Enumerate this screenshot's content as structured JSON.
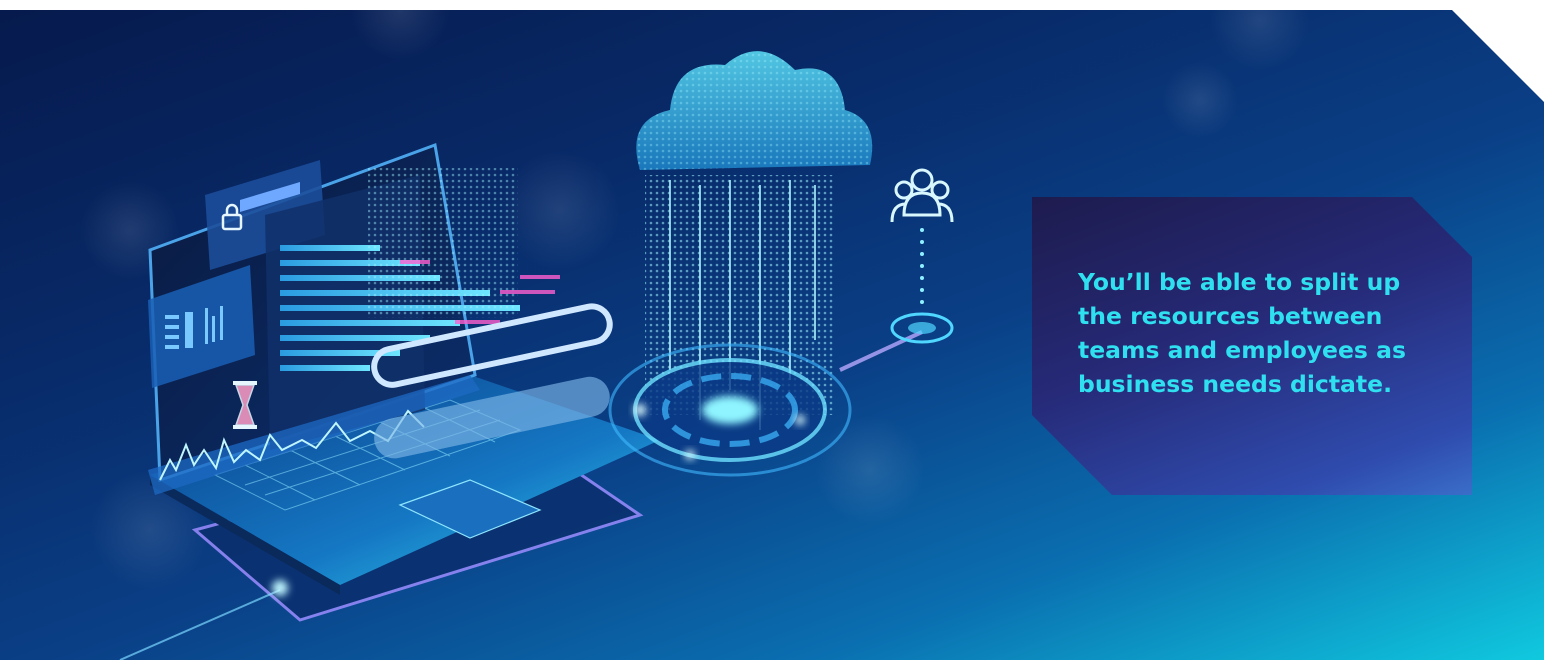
{
  "banner": {
    "callout_text": "You’ll be able to split up the resources between teams and employees as business needs dictate."
  },
  "illustration": {
    "icons": [
      "laptop-icon",
      "cloud-icon",
      "users-icon",
      "lock-icon",
      "hourglass-icon"
    ]
  },
  "colors": {
    "background_dark": "#061a4d",
    "background_light": "#10c9df",
    "callout_bg": "#262a78",
    "callout_text": "#2fe0f0",
    "glow": "#5fe8ff"
  }
}
